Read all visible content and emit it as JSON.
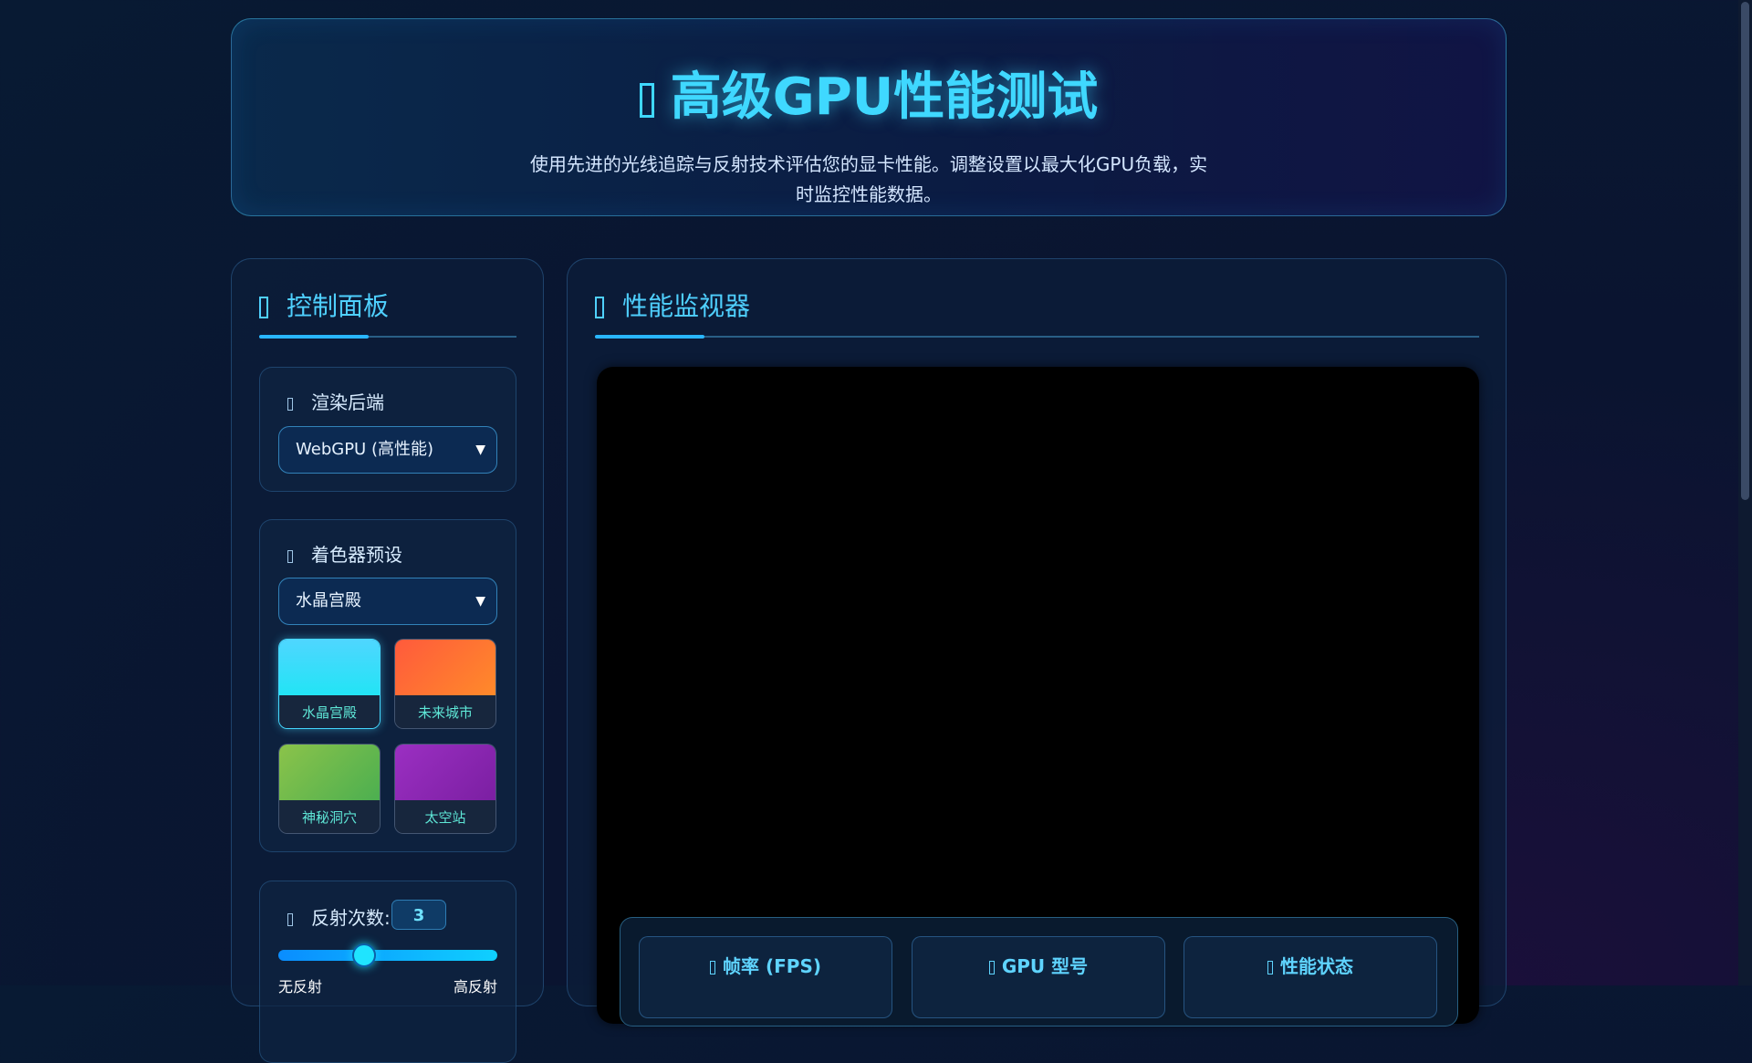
{
  "header": {
    "title": "高级GPU性能测试",
    "title_icon": "rocket-icon",
    "description": "使用先进的光线追踪与反射技术评估您的显卡性能。调整设置以最大化GPU负载，实时监控性能数据。"
  },
  "control_panel": {
    "title": "控制面板",
    "title_icon": "sliders-icon",
    "backend": {
      "label": "渲染后端",
      "icon": "chip-icon",
      "selected": "WebGPU (高性能)"
    },
    "shader": {
      "label": "着色器预设",
      "icon": "palette-icon",
      "selected": "水晶宫殿",
      "presets": [
        {
          "label": "水晶宫殿",
          "color": "#3fd8ff",
          "active": true
        },
        {
          "label": "未来城市",
          "color": "#ff6a33",
          "active": false
        },
        {
          "label": "神秘洞穴",
          "color": "#6fbf4a",
          "active": false
        },
        {
          "label": "太空站",
          "color": "#8e27b8",
          "active": false
        }
      ]
    },
    "reflections": {
      "label": "反射次数:",
      "icon": "mirror-icon",
      "value": "3",
      "level_fraction": 0.39,
      "min_label": "无反射",
      "max_label": "高反射"
    }
  },
  "monitor_panel": {
    "title": "性能监视器",
    "title_icon": "chart-icon",
    "stats": [
      {
        "label": "帧率 (FPS)",
        "icon": "speed-icon"
      },
      {
        "label": "GPU 型号",
        "icon": "gpu-icon"
      },
      {
        "label": "性能状态",
        "icon": "status-icon"
      }
    ]
  },
  "colors": {
    "accent": "#3fd8ff",
    "canvas": "#000000"
  }
}
